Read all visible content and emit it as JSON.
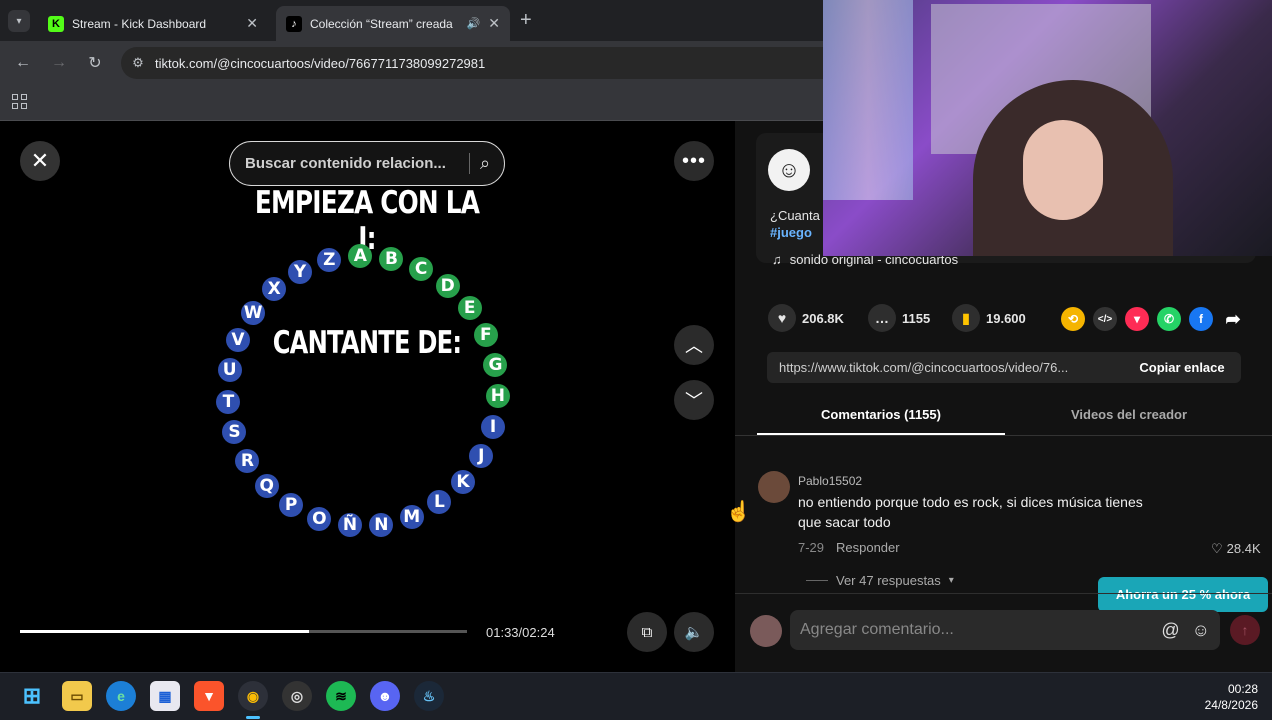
{
  "browser": {
    "tabs": [
      {
        "label": "Stream - Kick Dashboard",
        "icon": "kick-logo-icon"
      },
      {
        "label": "Colección “Stream” creada",
        "icon": "tiktok-logo-icon"
      }
    ],
    "url": "tiktok.com/@cincocuartoos/video/7667711738099272981"
  },
  "video": {
    "search_placeholder": "Buscar contenido relacion...",
    "title_text": "EMPIEZA CON LA I:",
    "center_text": "CANTANTE DE:",
    "letters": [
      "A",
      "B",
      "C",
      "D",
      "E",
      "F",
      "G",
      "H",
      "I",
      "J",
      "K",
      "L",
      "M",
      "N",
      "Ñ",
      "O",
      "P",
      "Q",
      "R",
      "S",
      "T",
      "U",
      "V",
      "W",
      "X",
      "Y",
      "Z"
    ],
    "letter_colors": {
      "answered": "#27a04b",
      "pending": "#2f4fb0"
    },
    "time": "01:33/02:24",
    "progress": 0.646
  },
  "post": {
    "caption_start": "¿Cuanta",
    "hashtag": "#juego",
    "sound": "sonido original - cincocuartos",
    "likes": "206.8K",
    "comments": "1155",
    "saves": "19.600",
    "link": "https://www.tiktok.com/@cincocuartoos/video/76...",
    "copy_label": "Copiar enlace",
    "tab_comments": "Comentarios (1155)",
    "tab_creator": "Videos del creador"
  },
  "comment": {
    "user": "Pablo15502",
    "text_line1": "no entiendo porque todo es rock, si dices música tienes",
    "text_line2": "que sacar todo",
    "date": "7-29",
    "reply": "Responder",
    "likes": "28.4K",
    "view_replies": "Ver 47 respuestas"
  },
  "promo": "Ahorra un 25 % ahora",
  "comment_input_placeholder": "Agregar comentario...",
  "taskbar": {
    "time": "00:28",
    "date": "24/8/2026"
  }
}
